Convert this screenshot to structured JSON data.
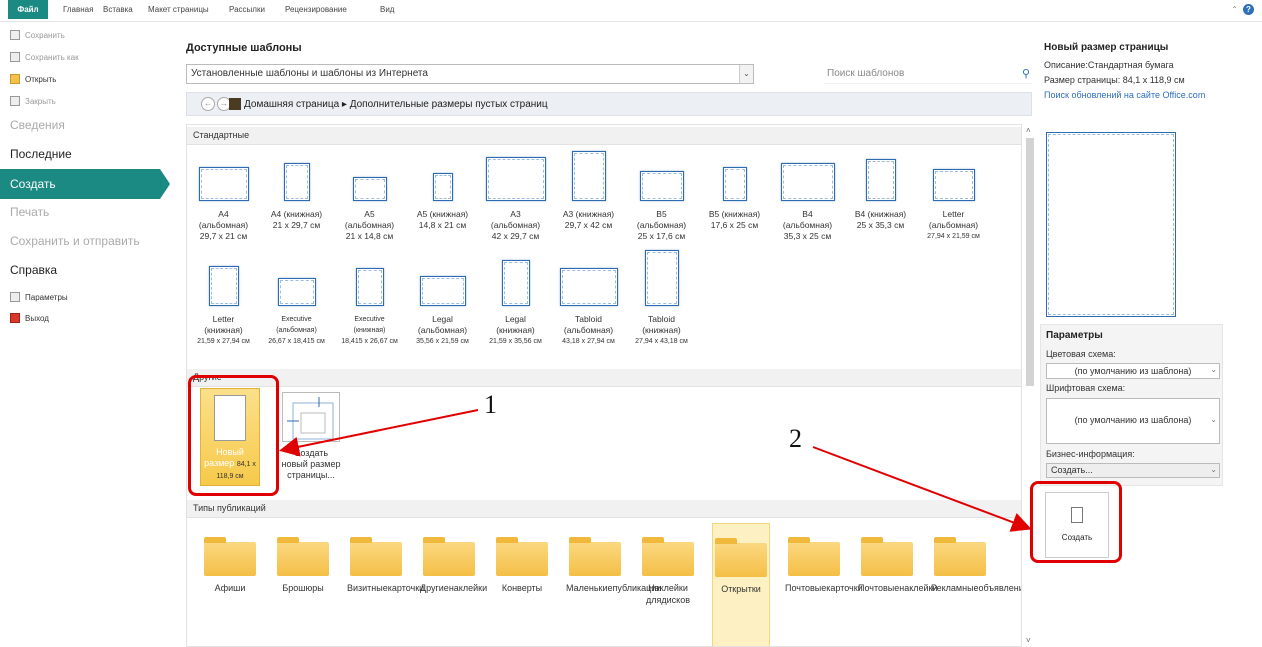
{
  "ribbon": {
    "file": "Файл",
    "tabs": [
      "Главная",
      "Вставка",
      "Макет страницы",
      "Рассылки",
      "Рецензирование",
      "Вид"
    ],
    "help": "?"
  },
  "sidebar": {
    "save": "Сохранить",
    "save_as": "Сохранить как",
    "open": "Открыть",
    "close": "Закрыть",
    "info": "Сведения",
    "recent": "Последние",
    "create": "Создать",
    "print": "Печать",
    "send": "Сохранить и отправить",
    "help": "Справка",
    "options": "Параметры",
    "exit": "Выход"
  },
  "main": {
    "title": "Доступные шаблоны",
    "combo": "Установленные шаблоны и шаблоны из Интернета",
    "search_placeholder": "Поиск шаблонов",
    "breadcrumb": "Домашняя страница ▸ Дополнительные размеры пустых страниц",
    "sections": {
      "standard": "Стандартные",
      "other": "Другие",
      "types": "Типы публикаций"
    },
    "standard": [
      {
        "name": "A4",
        "orient": "(альбомная)",
        "size": "29,7 x 21 см"
      },
      {
        "name": "A4 (книжная)",
        "orient": "",
        "size": "21 x 29,7 см"
      },
      {
        "name": "A5",
        "orient": "(альбомная)",
        "size": "21 x 14,8 см"
      },
      {
        "name": "A5 (книжная)",
        "orient": "",
        "size": "14,8 x 21 см"
      },
      {
        "name": "A3",
        "orient": "(альбомная)",
        "size": "42 x 29,7 см"
      },
      {
        "name": "A3 (книжная)",
        "orient": "",
        "size": "29,7 x 42 см"
      },
      {
        "name": "B5",
        "orient": "(альбомная)",
        "size": "25 x 17,6 см"
      },
      {
        "name": "B5 (книжная)",
        "orient": "",
        "size": "17,6 x 25 см"
      },
      {
        "name": "B4",
        "orient": "(альбомная)",
        "size": "35,3 x 25 см"
      },
      {
        "name": "B4 (книжная)",
        "orient": "",
        "size": "25 x 35,3 см"
      },
      {
        "name": "Letter",
        "orient": "(альбомная)",
        "size": "27,94 x 21,59 см"
      },
      {
        "name": "Letter",
        "orient": "(книжная)",
        "size": "21,59 x 27,94 см"
      },
      {
        "name": "Executive",
        "orient": "(альбомная)",
        "size": "26,67 x 18,415 см"
      },
      {
        "name": "Executive",
        "orient": "(книжная)",
        "size": "18,415 x 26,67 см"
      },
      {
        "name": "Legal",
        "orient": "(альбомная)",
        "size": "35,56 x 21,59 см"
      },
      {
        "name": "Legal",
        "orient": "(книжная)",
        "size": "21,59 x 35,56 см"
      },
      {
        "name": "Tabloid",
        "orient": "(альбомная)",
        "size": "43,18 x 27,94 см"
      },
      {
        "name": "Tabloid",
        "orient": "(книжная)",
        "size": "27,94 x 43,18 см"
      }
    ],
    "new_size": {
      "l1": "Новый",
      "l2": "размер",
      "size": "84,1 x 118,9 см"
    },
    "custom": {
      "l1": "Создать",
      "l2": "новый размер",
      "l3": "страницы..."
    },
    "types": [
      {
        "l1": "Афиши",
        "l2": ""
      },
      {
        "l1": "Брошюры",
        "l2": ""
      },
      {
        "l1": "Визитные",
        "l2": "карточки"
      },
      {
        "l1": "Другие",
        "l2": "наклейки"
      },
      {
        "l1": "Конверты",
        "l2": ""
      },
      {
        "l1": "Маленькие",
        "l2": "публикации"
      },
      {
        "l1": "Наклейки для",
        "l2": "дисков"
      },
      {
        "l1": "Открытки",
        "l2": ""
      },
      {
        "l1": "Почтовые",
        "l2": "карточки"
      },
      {
        "l1": "Почтовые",
        "l2": "наклейки"
      },
      {
        "l1": "Рекламные",
        "l2": "объявления"
      }
    ]
  },
  "right": {
    "title": "Новый размер страницы",
    "desc": "Описание:Стандартная бумага",
    "size": "Размер страницы: 84,1 x 118,9 см",
    "link": "Поиск обновлений на сайте Office.com",
    "params": "Параметры",
    "color_label": "Цветовая схема:",
    "color_value": "(по умолчанию из шаблона)",
    "font_label": "Шрифтовая схема:",
    "font_value": "(по умолчанию из шаблона)",
    "biz_label": "Бизнес-информация:",
    "biz_value": "Создать...",
    "create": "Создать"
  },
  "annotations": {
    "one": "1",
    "two": "2"
  }
}
